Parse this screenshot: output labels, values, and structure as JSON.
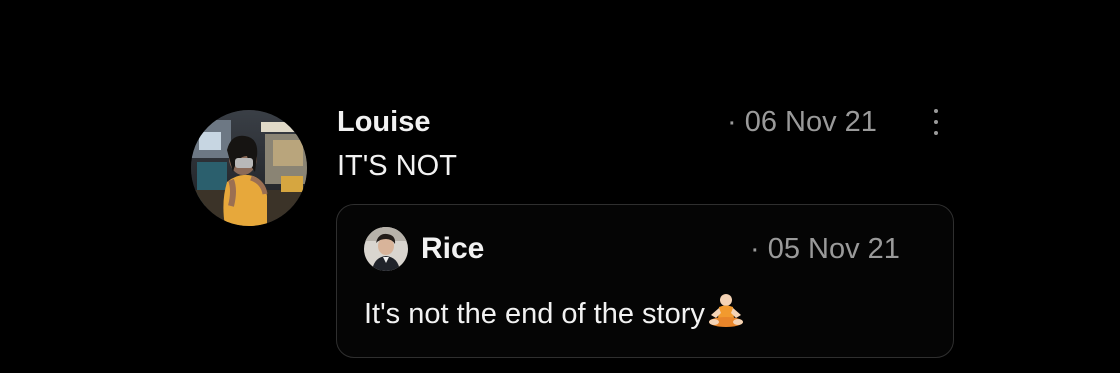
{
  "post": {
    "author": "Louise",
    "date_separator": "·",
    "date": "06 Nov 21",
    "text": "IT'S NOT",
    "avatar_icon": "profile-photo-avatar",
    "more_icon": "more-vertical-icon"
  },
  "quoted_post": {
    "author": "Rice",
    "date_separator": "·",
    "date": "05 Nov 21",
    "text": "It's not the end of the story",
    "emoji_icon": "person-in-lotus-position-emoji",
    "avatar_icon": "profile-photo-avatar"
  },
  "colors": {
    "background": "#000000",
    "primary_text": "#f2f2f2",
    "secondary_text": "#9a9a9a",
    "card_border": "#2f2f2f"
  }
}
